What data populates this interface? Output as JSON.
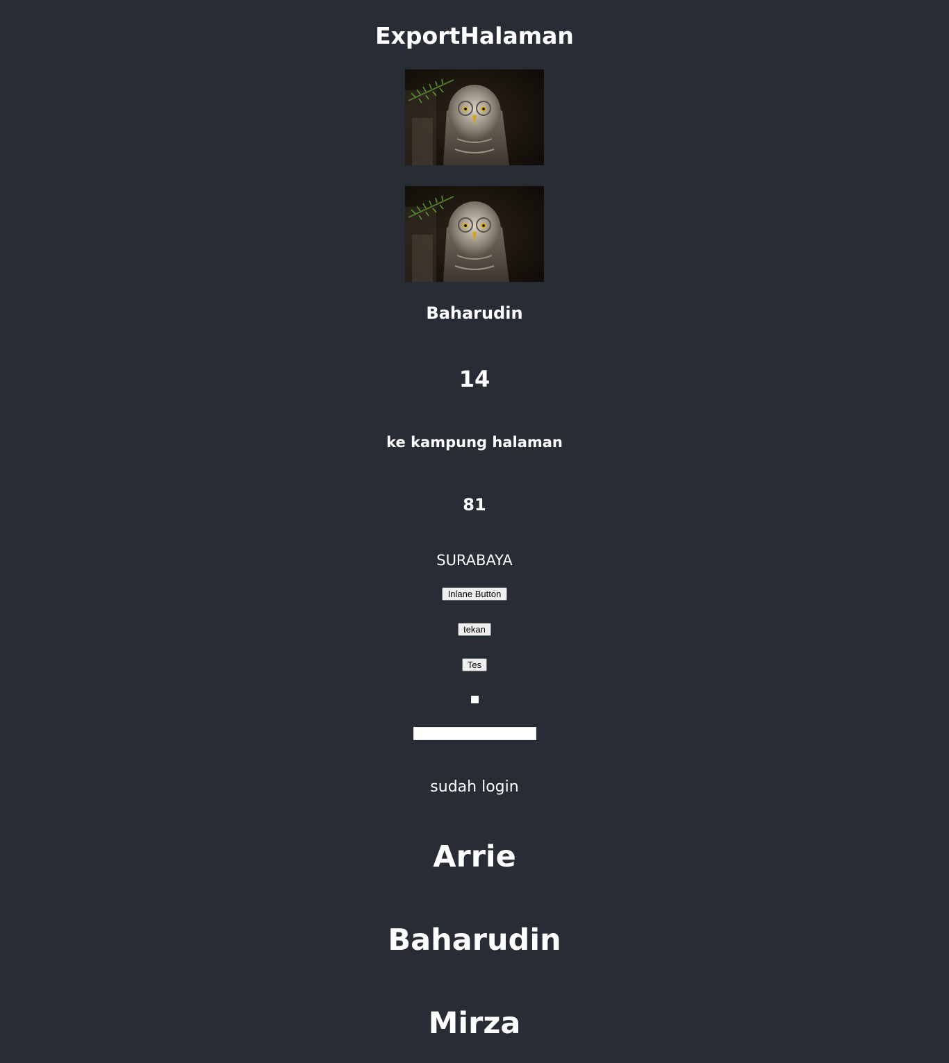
{
  "page": {
    "title": "ExportHalaman",
    "background_color": "#282c34"
  },
  "images": [
    {
      "name": "owl-photo"
    },
    {
      "name": "owl-photo"
    }
  ],
  "profile": {
    "name": "Baharudin",
    "age": "14",
    "destination": "ke kampung halaman",
    "number": "81",
    "city": "SURABAYA"
  },
  "buttons": {
    "inline_label": "Inlane Button",
    "tekan_label": "tekan",
    "tes_label": "Tes"
  },
  "form": {
    "checkbox_checked": false,
    "text_value": ""
  },
  "status": {
    "login_text": "sudah login"
  },
  "names": [
    "Arrie",
    "Baharudin",
    "Mirza"
  ]
}
